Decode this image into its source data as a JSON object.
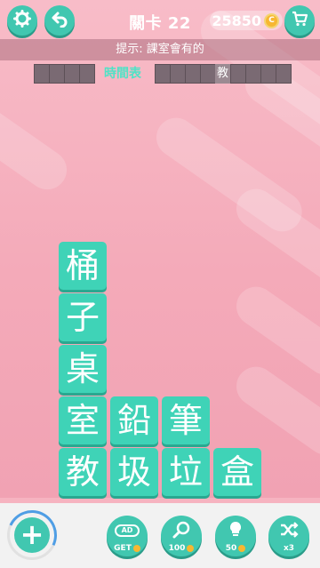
{
  "header": {
    "level_title": "關卡 22",
    "coins": "25850"
  },
  "hint": {
    "text": "提示: 課室會有的"
  },
  "answer_row": {
    "found_word": "時間表",
    "partial_char": "教"
  },
  "tiles": [
    {
      "char": "桶"
    },
    {
      "char": "子"
    },
    {
      "char": "桌"
    },
    {
      "char": "室"
    },
    {
      "char": "鉛"
    },
    {
      "char": "筆"
    },
    {
      "char": "教"
    },
    {
      "char": "圾"
    },
    {
      "char": "垃"
    },
    {
      "char": "盒"
    }
  ],
  "toolbar": {
    "ad_label": "AD",
    "get_label": "GET",
    "magnify_cost": "100",
    "hint_cost": "50",
    "shuffle_count": "x3"
  },
  "colors": {
    "accent": "#41c7b0",
    "tile": "#3fd3b7",
    "background": "#f6b3c0",
    "coin": "#f7b731"
  }
}
